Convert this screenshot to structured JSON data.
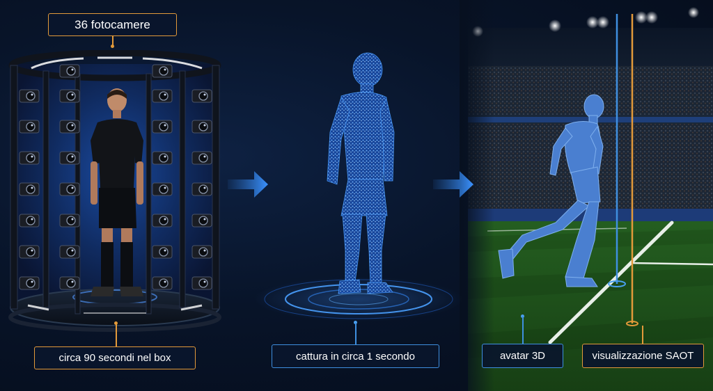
{
  "panels": {
    "capture_box": {
      "top_label": "36 fotocamere",
      "bottom_label": "circa 90 secondi nel box"
    },
    "hologram": {
      "bottom_label": "cattura in circa 1 secondo"
    },
    "stadium": {
      "avatar_label": "avatar 3D",
      "saot_label": "visualizzazione SAOT"
    }
  },
  "colors": {
    "accent_orange": "#e39a3a",
    "accent_blue": "#3f8fe0",
    "background": "#07101f",
    "pitch_green": "#1f5a1c"
  },
  "icons": [
    "camera-icon",
    "arrow-right-icon",
    "arrow-right-icon"
  ]
}
